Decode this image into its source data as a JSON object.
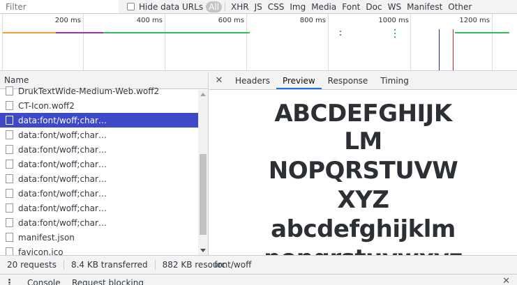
{
  "filter": {
    "placeholder": "Filter"
  },
  "hide_data_urls": "Hide data URLs",
  "type_filters": [
    "All",
    "XHR",
    "JS",
    "CSS",
    "Img",
    "Media",
    "Font",
    "Doc",
    "WS",
    "Manifest",
    "Other"
  ],
  "timeline": {
    "ticks": [
      "200 ms",
      "400 ms",
      "600 ms",
      "800 ms",
      "1000 ms",
      "1200 ms"
    ]
  },
  "request_list": {
    "header": "Name",
    "rows": [
      "DrukTextWide-Medium-Web.woff2",
      "CT-Icon.woff2",
      "data:font/woff;char…",
      "data:font/woff;char…",
      "data:font/woff;char…",
      "data:font/woff;char…",
      "data:font/woff;char…",
      "data:font/woff;char…",
      "data:font/woff;char…",
      "data:font/woff;char…",
      "manifest.json",
      "favicon.ico"
    ],
    "selected_index": 2
  },
  "detail_tabs": [
    "Headers",
    "Preview",
    "Response",
    "Timing"
  ],
  "active_tab": "Preview",
  "preview": {
    "lines": [
      "ABCDEFGHIJK",
      "LM",
      "NOPQRSTUVW",
      "XYZ",
      "abcdefghijklm",
      "nopqrstuvwxyz"
    ]
  },
  "status": {
    "requests": "20 requests",
    "transferred": "8.4 KB transferred",
    "resources": "882 KB resourc",
    "mime": "font/woff"
  },
  "drawer": {
    "tabs": [
      "Console",
      "Request blocking"
    ]
  }
}
